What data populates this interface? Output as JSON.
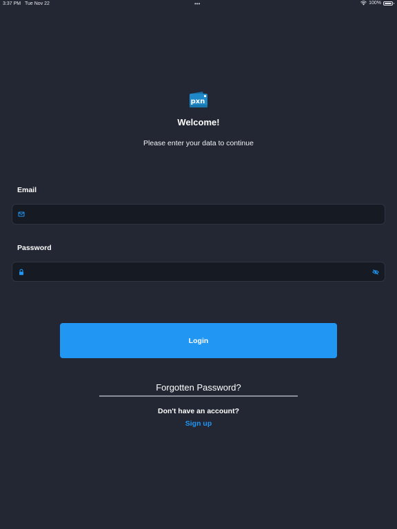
{
  "status_bar": {
    "time": "3:37 PM",
    "date": "Tue Nov 22",
    "dots": "•••",
    "battery": "100%"
  },
  "logo": {
    "text": "pxn",
    "color": "#2196f3"
  },
  "header": {
    "title": "Welcome!",
    "subtitle": "Please enter your data to continue"
  },
  "form": {
    "email_label": "Email",
    "email_value": "",
    "email_placeholder": "",
    "password_label": "Password",
    "password_value": "",
    "password_placeholder": "",
    "login_label": "Login"
  },
  "footer": {
    "forgot_password": "Forgotten Password?",
    "no_account": "Don't have an account?",
    "signup": "Sign up"
  },
  "colors": {
    "background": "#222733",
    "input_background": "#161a22",
    "accent": "#2196f3",
    "text": "#ffffff"
  },
  "icons": {
    "email": "mail-icon",
    "password": "lock-icon",
    "toggle_password": "eye-off-icon"
  }
}
